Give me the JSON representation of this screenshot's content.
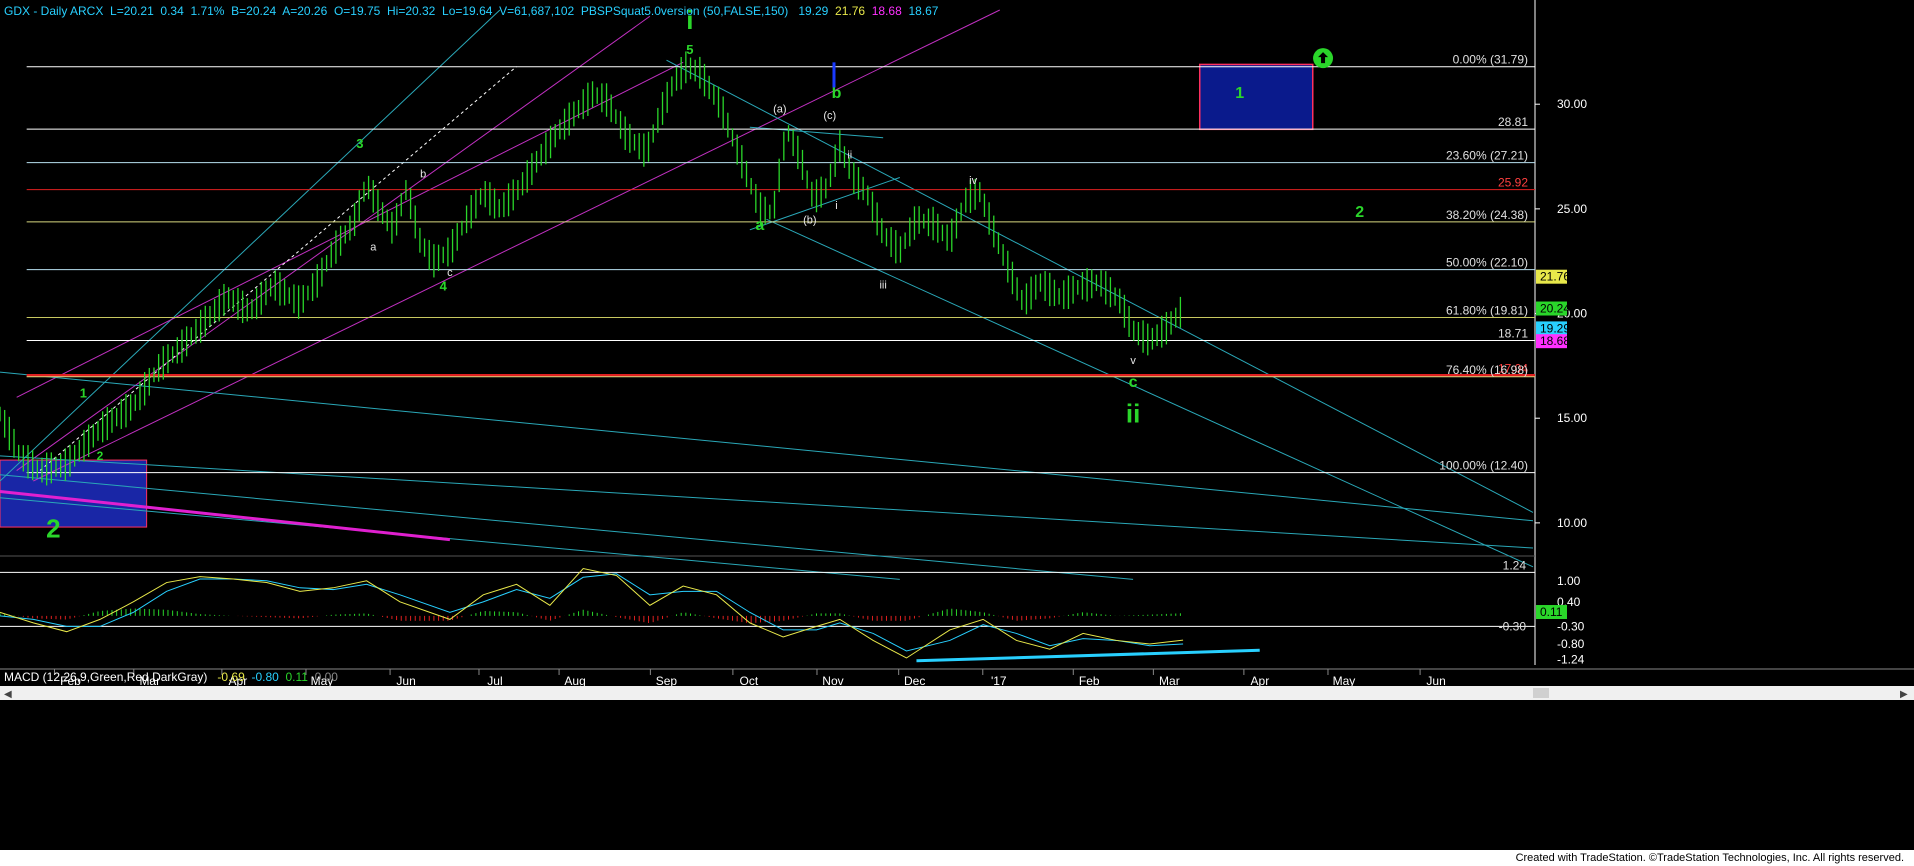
{
  "header": {
    "symbol": "GDX - Daily ARCX",
    "last": "L=20.21",
    "change": "0.34",
    "change_pct": "1.71%",
    "bid": "B=20.24",
    "ask": "A=20.26",
    "open": "O=19.75",
    "high": "Hi=20.32",
    "low": "Lo=19.64",
    "volume": "V=61,687,102",
    "study": "PBSPSquat5.0version (50,FALSE,150)",
    "study_vals": [
      "19.29",
      "21.76",
      "18.68",
      "18.67"
    ],
    "study_colors": [
      "#28d0ff",
      "#e8e84a",
      "#ff30ff",
      "#28d0ff"
    ]
  },
  "macd_header": {
    "label": "MACD (12,26,9,Green,Red,DarkGray)",
    "vals": [
      "-0.69",
      "-0.80",
      "0.11",
      "0.00"
    ],
    "colors": [
      "#e8e84a",
      "#28d0ff",
      "#2ad62a",
      "#888888"
    ]
  },
  "credit": "Created with TradeStation. ©TradeStation Technologies, Inc. All rights reserved.",
  "chart_data": {
    "type": "line",
    "title": "GDX - Daily ARCX",
    "price_axis": {
      "ticks": [
        "30.00",
        "25.00",
        "20.00",
        "15.00",
        "10.00"
      ],
      "range": [
        8.8,
        34.5
      ]
    },
    "time_axis": {
      "ticks": [
        "Feb",
        "Mar",
        "Apr",
        "May",
        "Jun",
        "Jul",
        "Aug",
        "Sep",
        "Oct",
        "Nov",
        "Dec",
        "'17",
        "Feb",
        "Mar",
        "Apr",
        "May",
        "Jun"
      ]
    },
    "horizontal_levels": [
      {
        "price": 31.79,
        "label": "0.00% (31.79)",
        "color": "#ffffff",
        "width": 1
      },
      {
        "price": 28.81,
        "label": "28.81",
        "color": "#ffffff",
        "width": 1
      },
      {
        "price": 27.21,
        "label": "23.60% (27.21)",
        "color": "#b8e0f0",
        "width": 1
      },
      {
        "price": 25.92,
        "label": "25.92",
        "color": "#e02020",
        "width": 1
      },
      {
        "price": 24.38,
        "label": "38.20% (24.38)",
        "color": "#d8d880",
        "width": 1
      },
      {
        "price": 22.1,
        "label": "50.00% (22.10)",
        "color": "#b8e0f0",
        "width": 1
      },
      {
        "price": 19.81,
        "label": "61.80% (19.81)",
        "color": "#c8c860",
        "width": 1
      },
      {
        "price": 18.71,
        "label": "18.71",
        "color": "#ffffff",
        "width": 1
      },
      {
        "price": 17.04,
        "label": "17.04",
        "color": "#e02020",
        "width": 3
      },
      {
        "price": 16.98,
        "label": "76.40% (16.98)",
        "color": "#d8d880",
        "width": 1
      },
      {
        "price": 12.4,
        "label": "100.00% (12.40)",
        "color": "#ffffff",
        "width": 1
      }
    ],
    "price_badges": [
      {
        "price": 21.76,
        "text": "21.76",
        "bg": "#e8e84a",
        "fg": "#000000"
      },
      {
        "price": 20.24,
        "text": "20.24",
        "bg": "#2ad62a",
        "fg": "#000000"
      },
      {
        "price": 19.29,
        "text": "19.29",
        "bg": "#28d0ff",
        "fg": "#000000"
      },
      {
        "price": 18.68,
        "text": "18.68",
        "bg": "#ff30ff",
        "fg": "#000000"
      }
    ],
    "price_path": [
      [
        0,
        15.2
      ],
      [
        6,
        13.2
      ],
      [
        12,
        12.5
      ],
      [
        20,
        12.8
      ],
      [
        30,
        14.5
      ],
      [
        40,
        15.6
      ],
      [
        48,
        17.5
      ],
      [
        55,
        18.5
      ],
      [
        62,
        19.7
      ],
      [
        68,
        20.8
      ],
      [
        75,
        20.1
      ],
      [
        82,
        21.4
      ],
      [
        90,
        20.5
      ],
      [
        95,
        21.5
      ],
      [
        100,
        23.0
      ],
      [
        106,
        24.3
      ],
      [
        110,
        26.2
      ],
      [
        114,
        25.0
      ],
      [
        118,
        24.0
      ],
      [
        122,
        26.0
      ],
      [
        126,
        23.5
      ],
      [
        130,
        22.5
      ],
      [
        135,
        23.0
      ],
      [
        140,
        24.5
      ],
      [
        145,
        25.8
      ],
      [
        150,
        25.0
      ],
      [
        156,
        26.0
      ],
      [
        162,
        27.5
      ],
      [
        168,
        28.8
      ],
      [
        172,
        29.5
      ],
      [
        178,
        30.5
      ],
      [
        182,
        30.2
      ],
      [
        188,
        28.5
      ],
      [
        194,
        27.7
      ],
      [
        198,
        29.5
      ],
      [
        202,
        31.0
      ],
      [
        206,
        31.8
      ],
      [
        210,
        31.5
      ],
      [
        216,
        30.0
      ],
      [
        222,
        27.5
      ],
      [
        228,
        25.0
      ],
      [
        232,
        24.8
      ],
      [
        236,
        28.8
      ],
      [
        240,
        27.5
      ],
      [
        244,
        25.5
      ],
      [
        248,
        26.0
      ],
      [
        252,
        28.0
      ],
      [
        256,
        26.5
      ],
      [
        260,
        25.8
      ],
      [
        265,
        23.8
      ],
      [
        270,
        23.0
      ],
      [
        275,
        24.5
      ],
      [
        280,
        24.3
      ],
      [
        285,
        23.5
      ],
      [
        290,
        25.5
      ],
      [
        294,
        25.8
      ],
      [
        298,
        24.0
      ],
      [
        303,
        22.0
      ],
      [
        307,
        20.5
      ],
      [
        312,
        21.5
      ],
      [
        318,
        20.8
      ],
      [
        324,
        21.3
      ],
      [
        330,
        21.5
      ],
      [
        336,
        20.6
      ],
      [
        340,
        19.2
      ],
      [
        345,
        18.7
      ],
      [
        350,
        19.3
      ],
      [
        355,
        20.2
      ]
    ],
    "wave_labels": [
      {
        "text": "i",
        "t": 207,
        "p": 33.6,
        "color": "#2ad62a",
        "size": 26,
        "bold": true
      },
      {
        "text": "5",
        "t": 207,
        "p": 32.4,
        "color": "#2ad62a",
        "size": 13,
        "bold": true
      },
      {
        "text": "3",
        "t": 108,
        "p": 27.9,
        "color": "#2ad62a",
        "size": 13,
        "bold": true
      },
      {
        "text": "4",
        "t": 133,
        "p": 21.1,
        "color": "#2ad62a",
        "size": 13,
        "bold": true
      },
      {
        "text": "1",
        "t": 25,
        "p": 16.0,
        "color": "#2ad62a",
        "size": 13,
        "bold": true
      },
      {
        "text": "2",
        "t": 30,
        "p": 13.0,
        "color": "#2ad62a",
        "size": 12,
        "bold": true
      },
      {
        "text": "2",
        "t": 16,
        "p": 9.3,
        "color": "#2ad62a",
        "size": 26,
        "bold": true
      },
      {
        "text": "a",
        "t": 112,
        "p": 23.0,
        "color": "#e8e8e8",
        "size": 11,
        "bold": false
      },
      {
        "text": "b",
        "t": 127,
        "p": 26.5,
        "color": "#e8e8e8",
        "size": 11,
        "bold": false
      },
      {
        "text": "c",
        "t": 135,
        "p": 21.8,
        "color": "#e8e8e8",
        "size": 11,
        "bold": false
      },
      {
        "text": "(a)",
        "t": 234,
        "p": 29.6,
        "color": "#e8e8e8",
        "size": 11,
        "bold": false
      },
      {
        "text": "(c)",
        "t": 249,
        "p": 29.3,
        "color": "#e8e8e8",
        "size": 11,
        "bold": false
      },
      {
        "text": "b",
        "t": 251,
        "p": 30.3,
        "color": "#2ad62a",
        "size": 16,
        "bold": true
      },
      {
        "text": "a",
        "t": 228,
        "p": 24.0,
        "color": "#2ad62a",
        "size": 16,
        "bold": true
      },
      {
        "text": "(b)",
        "t": 243,
        "p": 24.3,
        "color": "#e8e8e8",
        "size": 11,
        "bold": false
      },
      {
        "text": "ii",
        "t": 255,
        "p": 27.4,
        "color": "#e8e8e8",
        "size": 11,
        "bold": false
      },
      {
        "text": "i",
        "t": 251,
        "p": 25.0,
        "color": "#e8e8e8",
        "size": 11,
        "bold": false
      },
      {
        "text": "iii",
        "t": 265,
        "p": 21.2,
        "color": "#e8e8e8",
        "size": 11,
        "bold": false
      },
      {
        "text": "iv",
        "t": 292,
        "p": 26.2,
        "color": "#e8e8e8",
        "size": 11,
        "bold": false
      },
      {
        "text": "v",
        "t": 340,
        "p": 17.6,
        "color": "#e8e8e8",
        "size": 11,
        "bold": false
      },
      {
        "text": "c",
        "t": 340,
        "p": 16.5,
        "color": "#2ad62a",
        "size": 16,
        "bold": true
      },
      {
        "text": "ii",
        "t": 340,
        "p": 14.8,
        "color": "#2ad62a",
        "size": 26,
        "bold": true
      },
      {
        "text": "1",
        "t": 372,
        "p": 30.3,
        "color": "#2ad62a",
        "size": 16,
        "bold": true
      },
      {
        "text": "2",
        "t": 408,
        "p": 24.6,
        "color": "#2ad62a",
        "size": 16,
        "bold": true
      }
    ]
  },
  "macd_data": {
    "axis_ticks": [
      "1.00",
      "0.40",
      "-0.30",
      "-0.80",
      "-1.24"
    ],
    "levels": [
      {
        "v": 1.24,
        "label": "1.24",
        "color": "#ffffff"
      },
      {
        "v": -0.3,
        "label": "-0.30",
        "color": "#ffffff"
      }
    ],
    "badges": [
      {
        "v": 0.11,
        "text": "0.11",
        "bg": "#2ad62a",
        "fg": "#000000"
      }
    ],
    "macd_path": [
      [
        0,
        0.1
      ],
      [
        10,
        -0.2
      ],
      [
        20,
        -0.45
      ],
      [
        30,
        -0.1
      ],
      [
        40,
        0.4
      ],
      [
        50,
        0.95
      ],
      [
        60,
        1.12
      ],
      [
        70,
        1.05
      ],
      [
        80,
        0.95
      ],
      [
        90,
        0.7
      ],
      [
        100,
        0.8
      ],
      [
        110,
        1.0
      ],
      [
        120,
        0.4
      ],
      [
        135,
        -0.1
      ],
      [
        145,
        0.6
      ],
      [
        155,
        0.9
      ],
      [
        165,
        0.3
      ],
      [
        175,
        1.35
      ],
      [
        185,
        1.15
      ],
      [
        195,
        0.3
      ],
      [
        205,
        0.85
      ],
      [
        215,
        0.6
      ],
      [
        225,
        -0.2
      ],
      [
        235,
        -0.6
      ],
      [
        245,
        -0.3
      ],
      [
        252,
        -0.1
      ],
      [
        262,
        -0.7
      ],
      [
        272,
        -1.2
      ],
      [
        285,
        -0.4
      ],
      [
        295,
        -0.1
      ],
      [
        305,
        -0.7
      ],
      [
        315,
        -0.95
      ],
      [
        325,
        -0.5
      ],
      [
        335,
        -0.7
      ],
      [
        345,
        -0.8
      ],
      [
        355,
        -0.69
      ]
    ],
    "signal_path": [
      [
        0,
        0.0
      ],
      [
        10,
        -0.1
      ],
      [
        20,
        -0.3
      ],
      [
        30,
        -0.3
      ],
      [
        40,
        0.1
      ],
      [
        50,
        0.7
      ],
      [
        60,
        1.05
      ],
      [
        70,
        1.05
      ],
      [
        80,
        1.0
      ],
      [
        90,
        0.8
      ],
      [
        100,
        0.75
      ],
      [
        110,
        0.9
      ],
      [
        120,
        0.6
      ],
      [
        135,
        0.1
      ],
      [
        145,
        0.4
      ],
      [
        155,
        0.75
      ],
      [
        165,
        0.5
      ],
      [
        175,
        1.1
      ],
      [
        185,
        1.2
      ],
      [
        195,
        0.6
      ],
      [
        205,
        0.7
      ],
      [
        215,
        0.7
      ],
      [
        225,
        0.1
      ],
      [
        235,
        -0.4
      ],
      [
        245,
        -0.4
      ],
      [
        252,
        -0.2
      ],
      [
        262,
        -0.5
      ],
      [
        272,
        -1.0
      ],
      [
        285,
        -0.7
      ],
      [
        295,
        -0.25
      ],
      [
        305,
        -0.5
      ],
      [
        315,
        -0.85
      ],
      [
        325,
        -0.65
      ],
      [
        335,
        -0.7
      ],
      [
        345,
        -0.85
      ],
      [
        355,
        -0.8
      ]
    ]
  }
}
